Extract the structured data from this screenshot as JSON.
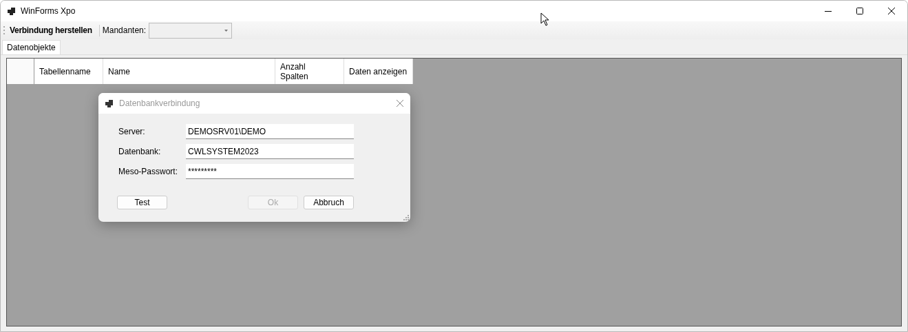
{
  "window": {
    "title": "WinForms Xpo"
  },
  "toolbar": {
    "connect_button": "Verbindung herstellen",
    "tenants_label": "Mandanten:",
    "tenants_combo": {
      "disabled": true
    }
  },
  "tabs": [
    {
      "label": "Datenobjekte",
      "selected": true
    }
  ],
  "table": {
    "columns": [
      {
        "kind": "row_header"
      },
      {
        "label": "Tabellenname"
      },
      {
        "label": "Name"
      },
      {
        "label": "Anzahl Spalten"
      },
      {
        "label": "Daten anzeigen"
      }
    ]
  },
  "dialog": {
    "title": "Datenbankverbindung",
    "fields": [
      {
        "label": "Server:",
        "value": "DEMOSRV01\\DEMO"
      },
      {
        "label": "Datenbank:",
        "value": "CWLSYSTEM2023"
      },
      {
        "label": "Meso-Passwort:",
        "value": "*********"
      }
    ],
    "buttons": [
      {
        "label": "Test",
        "kind": "left",
        "disabled": false
      },
      {
        "label": "Ok",
        "kind": "right",
        "disabled": true
      },
      {
        "label": "Abbruch",
        "kind": "right",
        "disabled": false
      }
    ]
  }
}
